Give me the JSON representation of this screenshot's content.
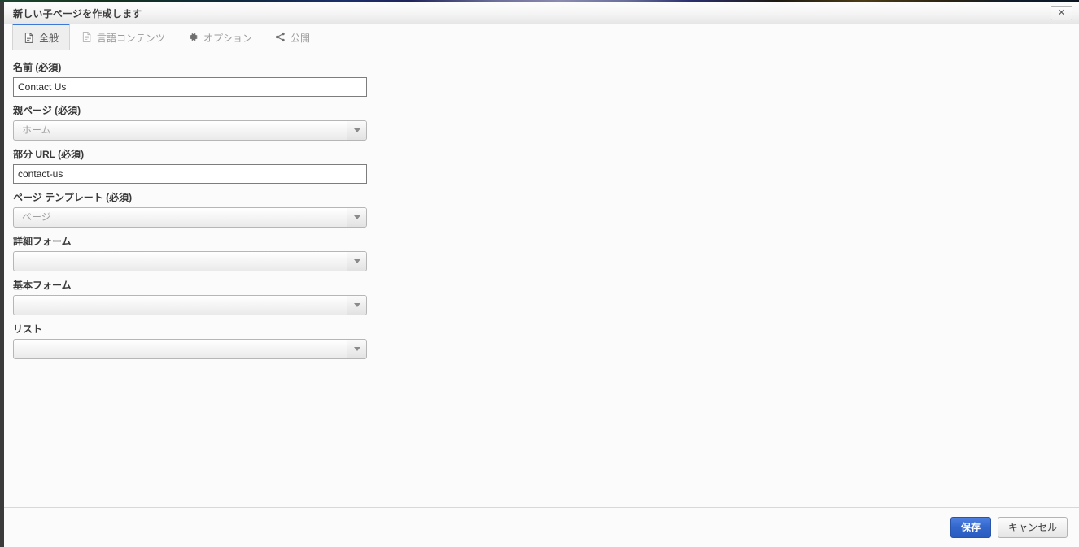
{
  "window": {
    "title": "新しい子ページを作成します",
    "close_label": "✕",
    "close_icon": "close-icon"
  },
  "tabs": [
    {
      "label": "全般",
      "icon": "document-icon",
      "active": true
    },
    {
      "label": "言語コンテンツ",
      "icon": "document-icon",
      "active": false
    },
    {
      "label": "オプション",
      "icon": "gear-icon",
      "active": false
    },
    {
      "label": "公開",
      "icon": "share-icon",
      "active": false
    }
  ],
  "form": {
    "fields": [
      {
        "label": "名前 (必須)",
        "type": "text",
        "value": "Contact Us",
        "placeholder": "",
        "name": "name-field"
      },
      {
        "label": "親ページ (必須)",
        "type": "select",
        "value": "ホーム",
        "muted": true,
        "name": "parent-page-select"
      },
      {
        "label": "部分 URL (必須)",
        "type": "text",
        "value": "contact-us",
        "placeholder": "",
        "name": "url-slug-field"
      },
      {
        "label": "ページ テンプレート (必須)",
        "type": "select",
        "value": "ページ",
        "muted": true,
        "name": "page-template-select"
      },
      {
        "label": "詳細フォーム",
        "type": "select",
        "value": "",
        "muted": false,
        "name": "detail-form-select"
      },
      {
        "label": "基本フォーム",
        "type": "select",
        "value": "",
        "muted": false,
        "name": "basic-form-select"
      },
      {
        "label": "リスト",
        "type": "select",
        "value": "",
        "muted": false,
        "name": "list-select"
      }
    ]
  },
  "footer": {
    "save_label": "保存",
    "cancel_label": "キャンセル"
  },
  "colors": {
    "accent": "#3366cc",
    "active_tab_border": "#3b78d8",
    "dialog_bg": "#fbfbfb",
    "titlebar_border": "#cfcfcf",
    "window_left_border": "#3b3b3b"
  }
}
